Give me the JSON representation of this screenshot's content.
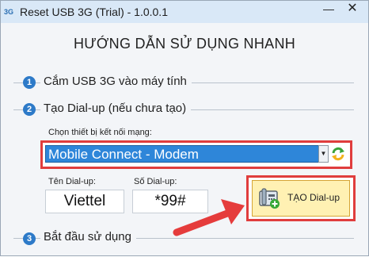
{
  "window": {
    "title": "Reset USB 3G (Trial) - 1.0.0.1",
    "icon_text": "3G",
    "minimize_label": "—",
    "close_label": "✕"
  },
  "heading": "HƯỚNG DẪN SỬ DỤNG NHANH",
  "steps": [
    {
      "number": "1",
      "label": "Cắm USB 3G vào máy tính"
    },
    {
      "number": "2",
      "label": "Tạo Dial-up (nếu chưa tạo)"
    },
    {
      "number": "3",
      "label": "Bắt đầu sử dụng"
    }
  ],
  "device": {
    "label": "Chọn thiết bị kết nối mạng:",
    "selected": "Mobile Connect - Modem",
    "dropdown_icon": "chevron-down-icon",
    "refresh_icon": "refresh-icon"
  },
  "dialup": {
    "name_label": "Tên Dial-up:",
    "name_value": "Viettel",
    "number_label": "Số Dial-up:",
    "number_value": "*99#",
    "create_button": "TẠO Dial-up",
    "create_icon": "phone-add-icon"
  },
  "colors": {
    "accent": "#2d7ac8",
    "highlight": "#e03d3d",
    "selection": "#2e86d9",
    "button_bg": "#fff1b3"
  }
}
